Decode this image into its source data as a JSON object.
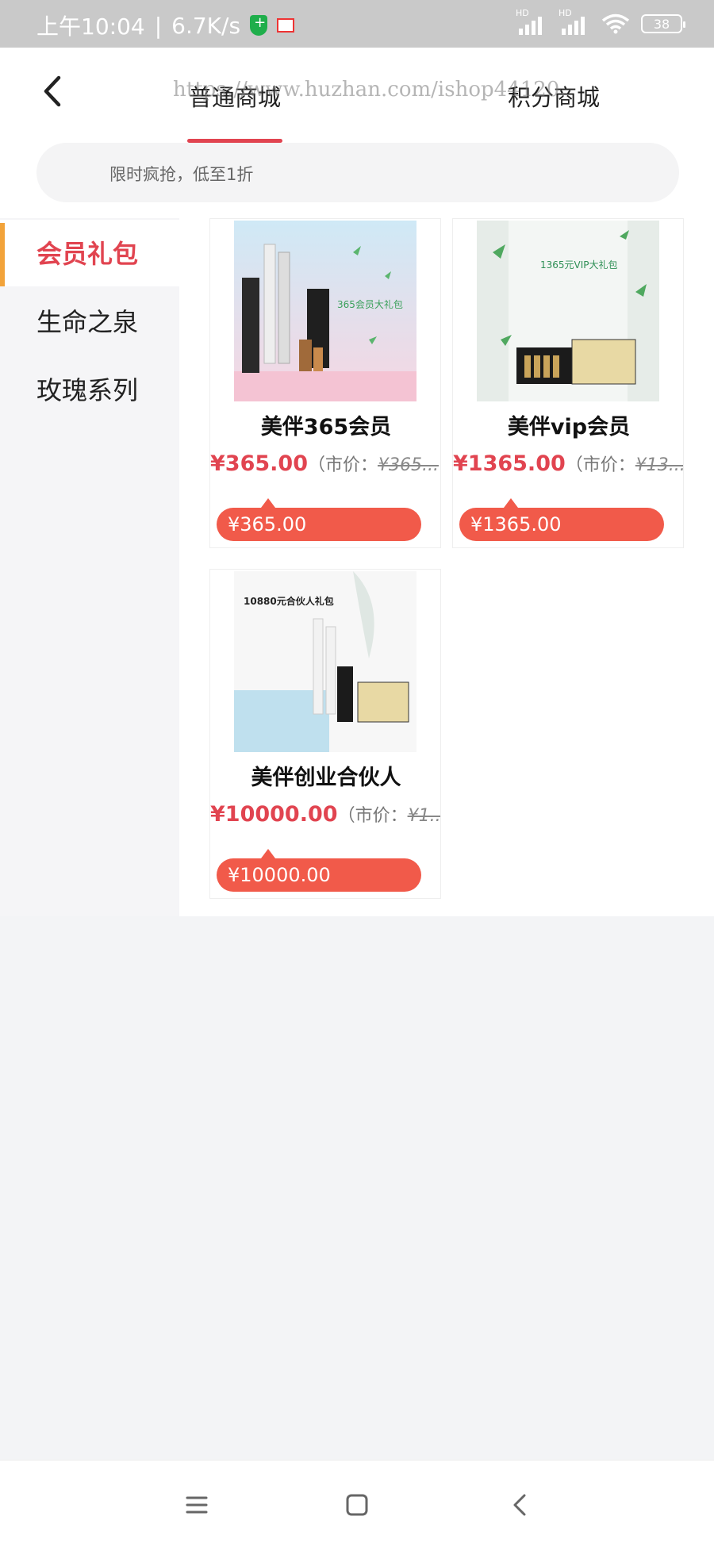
{
  "status": {
    "time": "上午10:04",
    "speed": "6.7K/s",
    "signal1": "HD",
    "signal2": "HD",
    "battery": "38"
  },
  "header": {
    "watermark": "https://www.huzhan.com/ishop44120",
    "tabs": [
      {
        "label": "普通商城",
        "active": true
      },
      {
        "label": "积分商城",
        "active": false
      }
    ]
  },
  "search": {
    "placeholder": "限时疯抢，低至1折"
  },
  "sidebar": {
    "items": [
      {
        "label": "会员礼包",
        "active": true
      },
      {
        "label": "生命之泉",
        "active": false
      },
      {
        "label": "玫瑰系列",
        "active": false
      }
    ]
  },
  "products": [
    {
      "name": "美伴365会员",
      "price": "¥365.00",
      "market_label": "（市价：",
      "market_price": "¥365...",
      "button": "¥365.00",
      "image_text": "365会员大礼包"
    },
    {
      "name": "美伴vip会员",
      "price": "¥1365.00",
      "market_label": "（市价：",
      "market_price": "¥13...",
      "button": "¥1365.00",
      "image_text": "1365元VIP大礼包"
    },
    {
      "name": "美伴创业合伙人",
      "price": "¥10000.00",
      "market_label": "（市价：",
      "market_price": "¥1...",
      "button": "¥10000.00",
      "image_text": "10880元合伙人礼包"
    }
  ],
  "colors": {
    "accent": "#e14450",
    "button": "#f15a4a",
    "sidebar_active_bar": "#f2a33a"
  }
}
